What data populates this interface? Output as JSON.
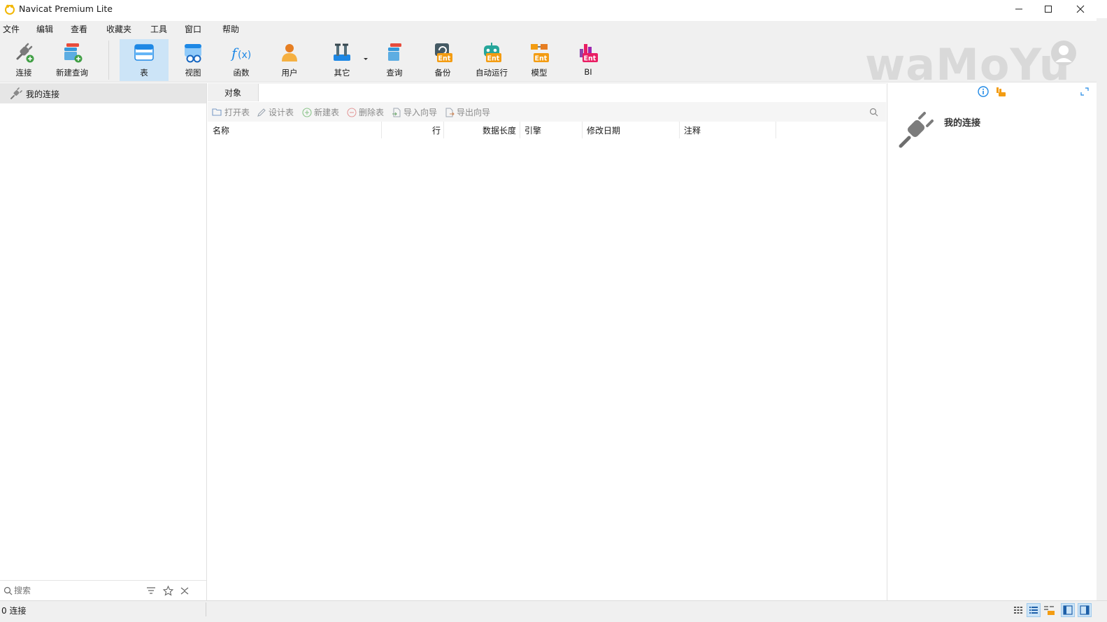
{
  "window": {
    "title": "Navicat Premium Lite",
    "controls": [
      "minimize-icon",
      "maximize-icon",
      "close-icon"
    ]
  },
  "menu": [
    "文件",
    "编辑",
    "查看",
    "收藏夹",
    "工具",
    "窗口",
    "帮助"
  ],
  "toolbar": {
    "items": [
      {
        "label": "连接",
        "icon": "connection-plug-icon"
      },
      {
        "label": "新建查询",
        "icon": "new-query-icon"
      },
      {
        "label": "表",
        "icon": "table-icon",
        "active": true
      },
      {
        "label": "视图",
        "icon": "view-icon"
      },
      {
        "label": "函数",
        "icon": "function-icon"
      },
      {
        "label": "用户",
        "icon": "user-icon"
      },
      {
        "label": "其它",
        "icon": "tools-icon"
      },
      {
        "label": "查询",
        "icon": "query-icon"
      },
      {
        "label": "备份",
        "icon": "backup-icon"
      },
      {
        "label": "自动运行",
        "icon": "automation-icon"
      },
      {
        "label": "模型",
        "icon": "model-icon"
      },
      {
        "label": "BI",
        "icon": "bi-icon"
      }
    ],
    "ent_badge": "Ent",
    "watermark": "waMoYu"
  },
  "sidebar": {
    "connection_label": "我的连接",
    "search_placeholder": "搜索"
  },
  "main": {
    "tab_label": "对象",
    "actions": [
      "打开表",
      "设计表",
      "新建表",
      "删除表",
      "导入向导",
      "导出向导"
    ],
    "columns": [
      "名称",
      "行",
      "数据长度",
      "引擎",
      "修改日期",
      "注释"
    ]
  },
  "right_panel": {
    "title": "我的连接"
  },
  "status": {
    "text": "0 连接"
  },
  "colors": {
    "active_tool_bg": "#cce4f7",
    "accent_blue": "#1e88e5",
    "ent_orange": "#f39c12"
  }
}
